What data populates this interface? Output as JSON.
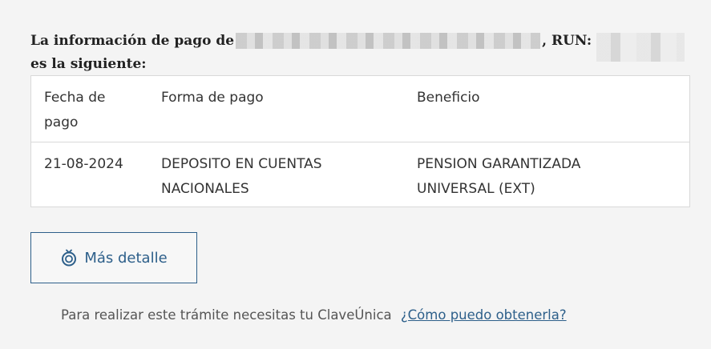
{
  "heading": {
    "prefix": "La información de pago de",
    "run_label": ", RUN:",
    "line2": "es la siguiente:"
  },
  "table": {
    "headers": [
      "Fecha de pago",
      "Forma de pago",
      "Beneficio"
    ],
    "rows": [
      [
        "21-08-2024",
        "DEPOSITO EN CUENTAS NACIONALES",
        "PENSION GARANTIZADA UNIVERSAL (EXT)"
      ]
    ]
  },
  "detail_button": {
    "label": "Más detalle",
    "icon": "coin-icon"
  },
  "footer": {
    "text": "Para realizar este trámite necesitas tu ClaveÚnica",
    "link": "¿Cómo puedo obtenerla?"
  },
  "colors": {
    "accent": "#2d5f8a",
    "background": "#f4f4f4",
    "border": "#d9d9d9"
  }
}
